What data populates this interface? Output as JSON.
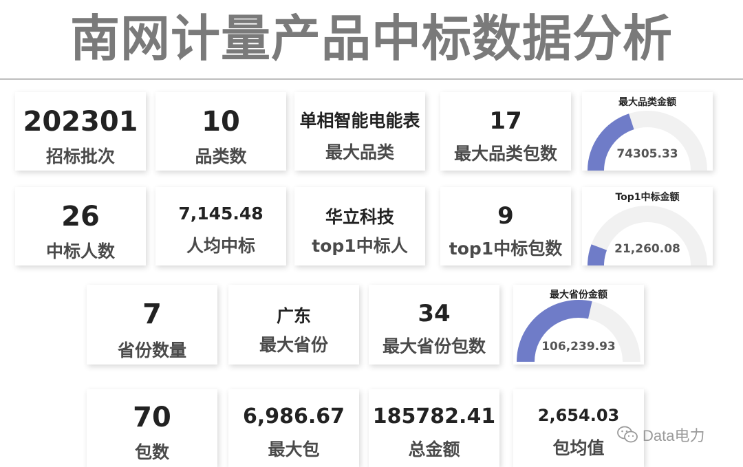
{
  "title": "南网计量产品中标数据分析",
  "colors": {
    "gauge_fill": "#6f7cc8",
    "gauge_track": "#f1f1f1"
  },
  "row1": [
    {
      "value": "202301",
      "label": "招标批次"
    },
    {
      "value": "10",
      "label": "品类数"
    },
    {
      "value": "单相智能电能表",
      "label": "最大品类"
    },
    {
      "value": "17",
      "label": "最大品类包数"
    }
  ],
  "row2": [
    {
      "value": "26",
      "label": "中标人数"
    },
    {
      "value": "7,145.48",
      "label": "人均中标"
    },
    {
      "value": "华立科技",
      "label": "top1中标人"
    },
    {
      "value": "9",
      "label": "top1中标包数"
    }
  ],
  "row3": [
    {
      "value": "7",
      "label": "省份数量"
    },
    {
      "value": "广东",
      "label": "最大省份"
    },
    {
      "value": "34",
      "label": "最大省份包数"
    }
  ],
  "row4": [
    {
      "value": "70",
      "label": "包数"
    },
    {
      "value": "6,986.67",
      "label": "最大包"
    },
    {
      "value": "185782.41",
      "label": "总金额"
    },
    {
      "value": "2,654.03",
      "label": "包均值"
    }
  ],
  "gauges": [
    {
      "title": "最大品类金额",
      "value": "74305.33",
      "fraction": 0.4
    },
    {
      "title": "Top1中标金额",
      "value": "21,260.08",
      "fraction": 0.115
    },
    {
      "title": "最大省份金额",
      "value": "106,239.93",
      "fraction": 0.57
    }
  ],
  "watermark": {
    "icon": "wechat-icon",
    "text": "Data电力"
  }
}
